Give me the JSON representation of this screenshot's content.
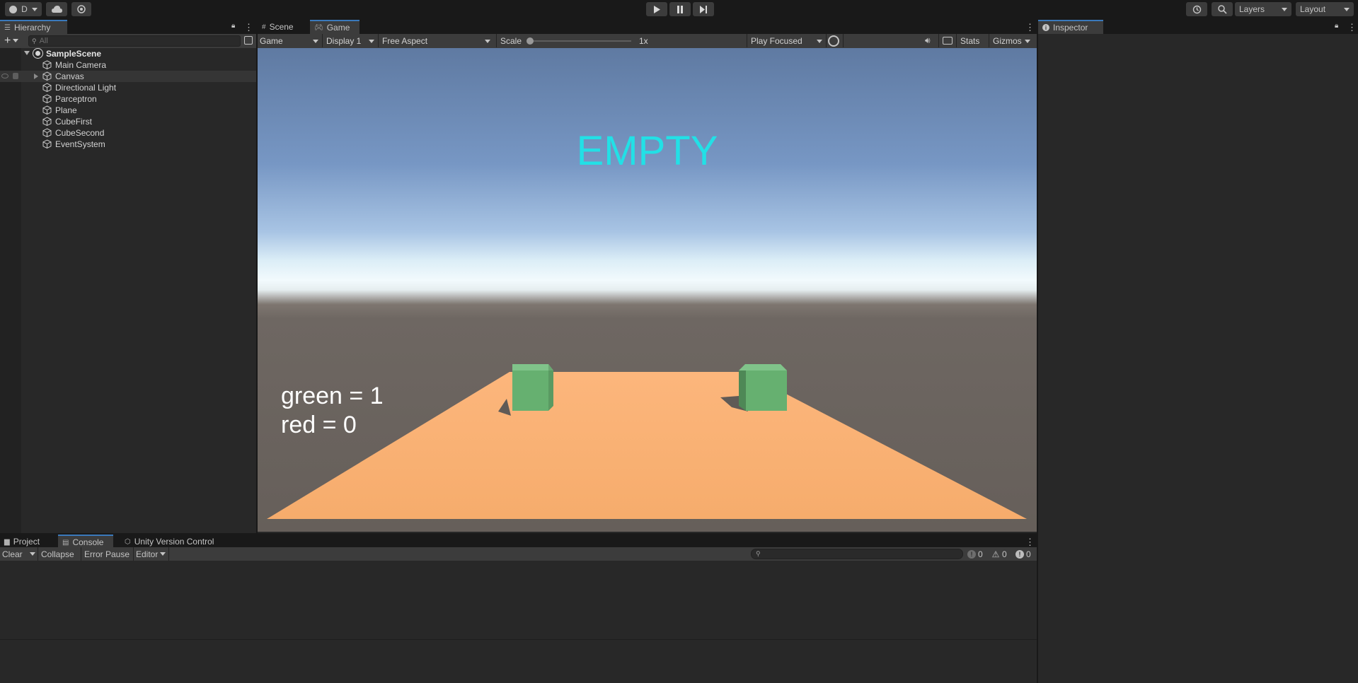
{
  "toolbar": {
    "account_label": "D",
    "layers_label": "Layers",
    "layout_label": "Layout"
  },
  "hierarchy": {
    "tab_label": "Hierarchy",
    "search_placeholder": "All",
    "scene_name": "SampleScene",
    "items": [
      {
        "label": "Main Camera"
      },
      {
        "label": "Canvas"
      },
      {
        "label": "Directional Light"
      },
      {
        "label": "Parceptron"
      },
      {
        "label": "Plane"
      },
      {
        "label": "CubeFirst"
      },
      {
        "label": "CubeSecond"
      },
      {
        "label": "EventSystem"
      }
    ]
  },
  "center": {
    "tabs": [
      {
        "label": "Scene"
      },
      {
        "label": "Game"
      }
    ],
    "game_toolbar": {
      "view_mode": "Game",
      "display": "Display 1",
      "aspect": "Free Aspect",
      "scale_label": "Scale",
      "scale_value": "1x",
      "play_mode": "Play Focused",
      "stats_label": "Stats",
      "gizmos_label": "Gizmos"
    },
    "game_view": {
      "status_text": "EMPTY",
      "green_line": "green = 1",
      "red_line": "red = 0",
      "status_color": "#22e0e6",
      "plane_color": "#f6ac6c",
      "cube_color": "#66b070"
    }
  },
  "inspector": {
    "tab_label": "Inspector"
  },
  "bottom": {
    "tabs": [
      {
        "label": "Project"
      },
      {
        "label": "Console"
      },
      {
        "label": "Unity Version Control"
      }
    ],
    "console_toolbar": {
      "clear_label": "Clear",
      "collapse_label": "Collapse",
      "error_pause_label": "Error Pause",
      "editor_label": "Editor",
      "log_count": "0",
      "warning_count": "0",
      "error_count": "0"
    }
  }
}
